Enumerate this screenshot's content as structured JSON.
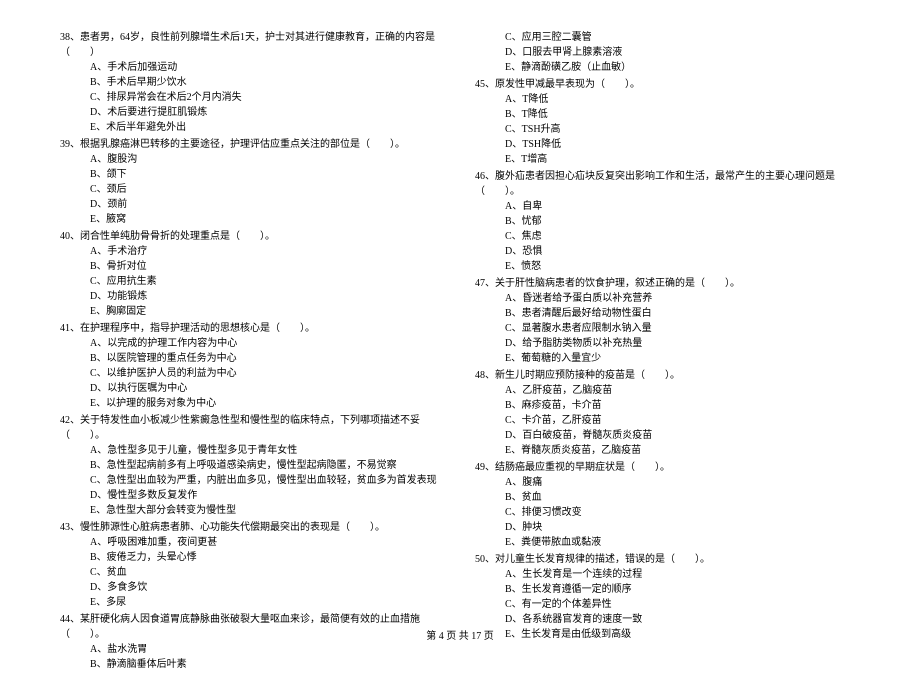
{
  "footer": "第 4 页 共 17 页",
  "left": {
    "q38": {
      "text": "38、患者男，64岁，良性前列腺增生术后1天，护士对其进行健康教育，正确的内容是（　　）",
      "opts": [
        "A、手术后加强运动",
        "B、手术后早期少饮水",
        "C、排尿异常会在术后2个月内消失",
        "D、术后要进行提肛肌锻炼",
        "E、术后半年避免外出"
      ]
    },
    "q39": {
      "text": "39、根据乳腺癌淋巴转移的主要途径，护理评估应重点关注的部位是（　　）。",
      "opts": [
        "A、腹股沟",
        "B、颌下",
        "C、颈后",
        "D、颈前",
        "E、腋窝"
      ]
    },
    "q40": {
      "text": "40、闭合性单纯肋骨骨折的处理重点是（　　）。",
      "opts": [
        "A、手术治疗",
        "B、骨折对位",
        "C、应用抗生素",
        "D、功能锻炼",
        "E、胸廓固定"
      ]
    },
    "q41": {
      "text": "41、在护理程序中，指导护理活动的思想核心是（　　）。",
      "opts": [
        "A、以完成的护理工作内容为中心",
        "B、以医院管理的重点任务为中心",
        "C、以维护医护人员的利益为中心",
        "D、以执行医嘱为中心",
        "E、以护理的服务对象为中心"
      ]
    },
    "q42": {
      "text": "42、关于特发性血小板减少性紫癜急性型和慢性型的临床特点，下列哪项描述不妥（　　）。",
      "opts": [
        "A、急性型多见于儿童，慢性型多见于青年女性",
        "B、急性型起病前多有上呼吸道感染病史，慢性型起病隐匿，不易觉察",
        "C、急性型出血较为严重，内脏出血多见，慢性型出血较轻，贫血多为首发表现",
        "D、慢性型多数反复发作",
        "E、急性型大部分会转变为慢性型"
      ]
    },
    "q43": {
      "text": "43、慢性肺源性心脏病患者肺、心功能失代偿期最突出的表现是（　　）。",
      "opts": [
        "A、呼吸困难加重，夜间更甚",
        "B、疲倦乏力，头晕心悸",
        "C、贫血",
        "D、多食多饮",
        "E、多尿"
      ]
    },
    "q44": {
      "text": "44、某肝硬化病人因食道胃底静脉曲张破裂大量呕血来诊，最简便有效的止血措施（　　）。",
      "opts": [
        "A、盐水洗胃",
        "B、静滴脑垂体后叶素"
      ]
    }
  },
  "right": {
    "q44c": {
      "opts": [
        "C、应用三腔二囊管",
        "D、口服去甲肾上腺素溶液",
        "E、静滴酚磺乙胺（止血敏）"
      ]
    },
    "q45": {
      "text": "45、原发性甲减最早表现为（　　）。",
      "opts": [
        "A、T降低",
        "B、T降低",
        "C、TSH升高",
        "D、TSH降低",
        "E、T增高"
      ]
    },
    "q46": {
      "text": "46、腹外疝患者因担心疝块反复突出影响工作和生活，最常产生的主要心理问题是（　　）。",
      "opts": [
        "A、自卑",
        "B、忧郁",
        "C、焦虑",
        "D、恐惧",
        "E、愤怒"
      ]
    },
    "q47": {
      "text": "47、关于肝性脑病患者的饮食护理，叙述正确的是（　　）。",
      "opts": [
        "A、昏迷者给予蛋白质以补充营养",
        "B、患者清醒后最好给动物性蛋白",
        "C、显著腹水患者应限制水钠入量",
        "D、给予脂肪类物质以补充热量",
        "E、葡萄糖的入量宜少"
      ]
    },
    "q48": {
      "text": "48、新生儿时期应预防接种的疫苗是（　　）。",
      "opts": [
        "A、乙肝疫苗，乙脑疫苗",
        "B、麻疹疫苗，卡介苗",
        "C、卡介苗，乙肝疫苗",
        "D、百白破疫苗，脊髓灰质炎疫苗",
        "E、脊髓灰质炎疫苗，乙脑疫苗"
      ]
    },
    "q49": {
      "text": "49、结肠癌最应重视的早期症状是（　　）。",
      "opts": [
        "A、腹痛",
        "B、贫血",
        "C、排便习惯改变",
        "D、肿块",
        "E、粪便带脓血或黏液"
      ]
    },
    "q50": {
      "text": "50、对儿童生长发育规律的描述，错误的是（　　）。",
      "opts": [
        "A、生长发育是一个连续的过程",
        "B、生长发育遵循一定的顺序",
        "C、有一定的个体差异性",
        "D、各系统器官发育的速度一致",
        "E、生长发育是由低级到高级"
      ]
    }
  }
}
